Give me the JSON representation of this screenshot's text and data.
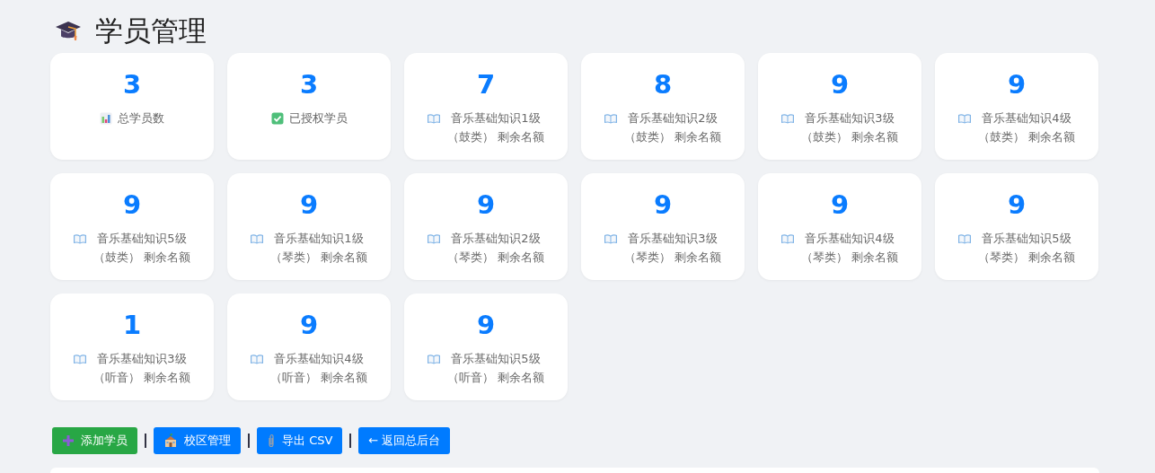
{
  "page": {
    "title": "学员管理"
  },
  "stats": [
    {
      "kind": "total",
      "value": "3",
      "label": "总学员数"
    },
    {
      "kind": "authorized",
      "value": "3",
      "label": "已授权学员"
    },
    {
      "kind": "quota",
      "value": "7",
      "label": "音乐基础知识1级（鼓类） 剩余名额"
    },
    {
      "kind": "quota",
      "value": "8",
      "label": "音乐基础知识2级（鼓类） 剩余名额"
    },
    {
      "kind": "quota",
      "value": "9",
      "label": "音乐基础知识3级（鼓类） 剩余名额"
    },
    {
      "kind": "quota",
      "value": "9",
      "label": "音乐基础知识4级（鼓类） 剩余名额"
    },
    {
      "kind": "quota",
      "value": "9",
      "label": "音乐基础知识5级（鼓类） 剩余名额"
    },
    {
      "kind": "quota",
      "value": "9",
      "label": "音乐基础知识1级（琴类） 剩余名额"
    },
    {
      "kind": "quota",
      "value": "9",
      "label": "音乐基础知识2级（琴类） 剩余名额"
    },
    {
      "kind": "quota",
      "value": "9",
      "label": "音乐基础知识3级（琴类） 剩余名额"
    },
    {
      "kind": "quota",
      "value": "9",
      "label": "音乐基础知识4级（琴类） 剩余名额"
    },
    {
      "kind": "quota",
      "value": "9",
      "label": "音乐基础知识5级（琴类） 剩余名额"
    },
    {
      "kind": "quota",
      "value": "1",
      "label": "音乐基础知识3级（听音） 剩余名额"
    },
    {
      "kind": "quota",
      "value": "9",
      "label": "音乐基础知识4级（听音） 剩余名额"
    },
    {
      "kind": "quota",
      "value": "9",
      "label": "音乐基础知识5级（听音） 剩余名额"
    }
  ],
  "actions": [
    {
      "kind": "add",
      "label": "添加学员"
    },
    {
      "kind": "campus",
      "label": "校区管理"
    },
    {
      "kind": "export",
      "label": "导出 CSV"
    },
    {
      "kind": "back",
      "label": "← 返回总后台"
    }
  ]
}
